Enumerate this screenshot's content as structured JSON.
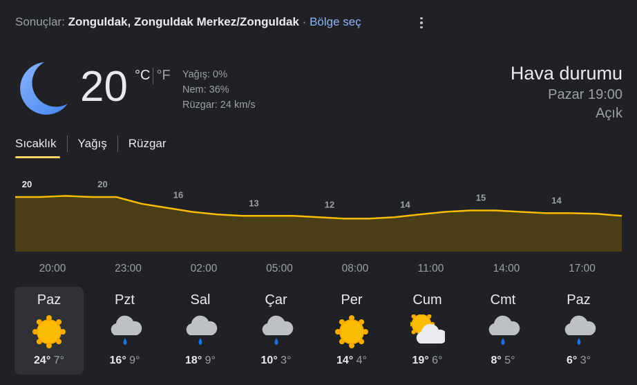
{
  "header": {
    "prefix": "Sonuçlar:",
    "location": "Zonguldak, Zonguldak Merkez/Zonguldak",
    "separator": "·",
    "region_link": "Bölge seç"
  },
  "current": {
    "temperature": "20",
    "unit_c": "°C",
    "unit_f": "°F",
    "precipitation": "Yağış: 0%",
    "humidity": "Nem: 36%",
    "wind": "Rüzgar: 24 km/s",
    "icon": "moon-icon"
  },
  "summary": {
    "title": "Hava durumu",
    "time": "Pazar 19:00",
    "condition": "Açık"
  },
  "tabs": [
    {
      "label": "Sıcaklık",
      "active": true
    },
    {
      "label": "Yağış",
      "active": false
    },
    {
      "label": "Rüzgar",
      "active": false
    }
  ],
  "chart_data": {
    "type": "area",
    "x": [
      "20:00",
      "21:00",
      "22:00",
      "23:00",
      "00:00",
      "01:00",
      "02:00",
      "03:00",
      "04:00",
      "05:00",
      "06:00",
      "07:00",
      "08:00",
      "09:00",
      "10:00",
      "11:00",
      "12:00",
      "13:00",
      "14:00",
      "15:00",
      "16:00",
      "17:00",
      "18:00",
      "19:00",
      "20:00"
    ],
    "values": [
      20,
      20,
      20.4,
      20,
      20,
      17.5,
      16,
      14.5,
      13.5,
      13,
      13,
      13,
      12.5,
      12,
      12,
      12.5,
      13.5,
      14.5,
      15,
      15,
      14.5,
      14,
      14,
      13.8,
      13
    ],
    "labels": [
      {
        "text": "20",
        "index": 0
      },
      {
        "text": "20",
        "index": 3
      },
      {
        "text": "16",
        "index": 6
      },
      {
        "text": "13",
        "index": 9
      },
      {
        "text": "12",
        "index": 12
      },
      {
        "text": "14",
        "index": 15
      },
      {
        "text": "15",
        "index": 18
      },
      {
        "text": "14",
        "index": 21
      }
    ],
    "tick_labels": [
      "20:00",
      "23:00",
      "02:00",
      "05:00",
      "08:00",
      "11:00",
      "14:00",
      "17:00"
    ],
    "colors": {
      "line": "#fbbc04",
      "fill": "#4a3e17"
    }
  },
  "days": [
    {
      "name": "Paz",
      "icon": "sun-icon",
      "hi": "24°",
      "lo": "7°",
      "selected": true
    },
    {
      "name": "Pzt",
      "icon": "rain-cloud-icon",
      "hi": "16°",
      "lo": "9°",
      "selected": false
    },
    {
      "name": "Sal",
      "icon": "rain-cloud-icon",
      "hi": "18°",
      "lo": "9°",
      "selected": false
    },
    {
      "name": "Çar",
      "icon": "rain-cloud-icon",
      "hi": "10°",
      "lo": "3°",
      "selected": false
    },
    {
      "name": "Per",
      "icon": "sun-icon",
      "hi": "14°",
      "lo": "4°",
      "selected": false
    },
    {
      "name": "Cum",
      "icon": "partly-cloudy-icon",
      "hi": "19°",
      "lo": "6°",
      "selected": false
    },
    {
      "name": "Cmt",
      "icon": "rain-cloud-icon",
      "hi": "8°",
      "lo": "5°",
      "selected": false
    },
    {
      "name": "Paz",
      "icon": "rain-cloud-icon",
      "hi": "6°",
      "lo": "3°",
      "selected": false
    }
  ]
}
